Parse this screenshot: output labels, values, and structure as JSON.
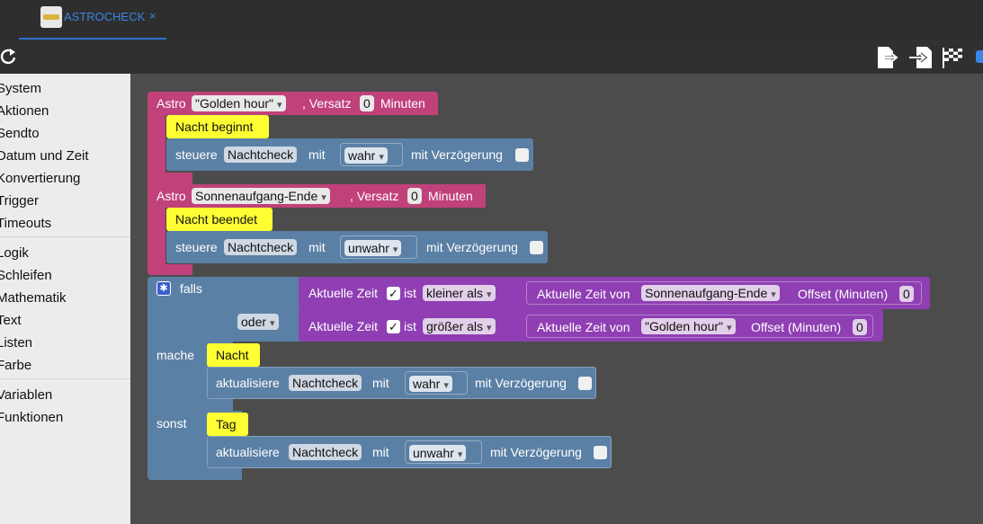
{
  "tab": {
    "label": "ASTROCHECK",
    "close": "×"
  },
  "toolbar": {
    "icons": [
      "refresh-icon",
      "export-icon",
      "import-icon",
      "checkered-flag-icon"
    ]
  },
  "sidebar": {
    "items": [
      "System",
      "Aktionen",
      "Sendto",
      "Datum und Zeit",
      "Konvertierung",
      "Trigger",
      "Timeouts",
      "Logik",
      "Schleifen",
      "Mathematik",
      "Text",
      "Listen",
      "Farbe",
      "Variablen",
      "Funktionen"
    ]
  },
  "astro1": {
    "astro": "Astro",
    "event": "\"Golden hour\"",
    "versatz": ", Versatz",
    "offset": "0",
    "minuten": "Minuten",
    "comment": "Nacht beginnt",
    "steuere": "steuere",
    "variable": "Nachtcheck",
    "mit": "mit",
    "value": "wahr",
    "delay": "mit Verzögerung"
  },
  "astro2": {
    "astro": "Astro",
    "event": "Sonnenaufgang-Ende",
    "versatz": ", Versatz",
    "offset": "0",
    "minuten": "Minuten",
    "comment": "Nacht beendet",
    "steuere": "steuere",
    "variable": "Nachtcheck",
    "mit": "mit",
    "value": "unwahr",
    "delay": "mit Verzögerung"
  },
  "ifblock": {
    "falls": "falls",
    "oder": "oder",
    "mache": "mache",
    "sonst": "sonst",
    "cond1": {
      "label": "Aktuelle Zeit",
      "check": "✓",
      "ist": "ist",
      "op": "kleiner als",
      "timeof": "Aktuelle Zeit von",
      "event": "Sonnenaufgang-Ende",
      "offsetlabel": "Offset (Minuten)",
      "offset": "0"
    },
    "cond2": {
      "label": "Aktuelle Zeit",
      "check": "✓",
      "ist": "ist",
      "op": "größer als",
      "timeof": "Aktuelle Zeit von",
      "event": "\"Golden hour\"",
      "offsetlabel": "Offset (Minuten)",
      "offset": "0"
    },
    "then": {
      "comment": "Nacht",
      "action": "aktualisiere",
      "variable": "Nachtcheck",
      "mit": "mit",
      "value": "wahr",
      "delay": "mit Verzögerung"
    },
    "else": {
      "comment": "Tag",
      "action": "aktualisiere",
      "variable": "Nachtcheck",
      "mit": "mit",
      "value": "unwahr",
      "delay": "mit Verzögerung"
    }
  },
  "colors": {
    "astro": "#c1417a",
    "control": "#5b80a5",
    "condition": "#8f3fb3",
    "comment": "#ffff33",
    "sidebar": "#ececec",
    "tabbar": "#2e2e2e",
    "accent": "#3a86e6"
  }
}
